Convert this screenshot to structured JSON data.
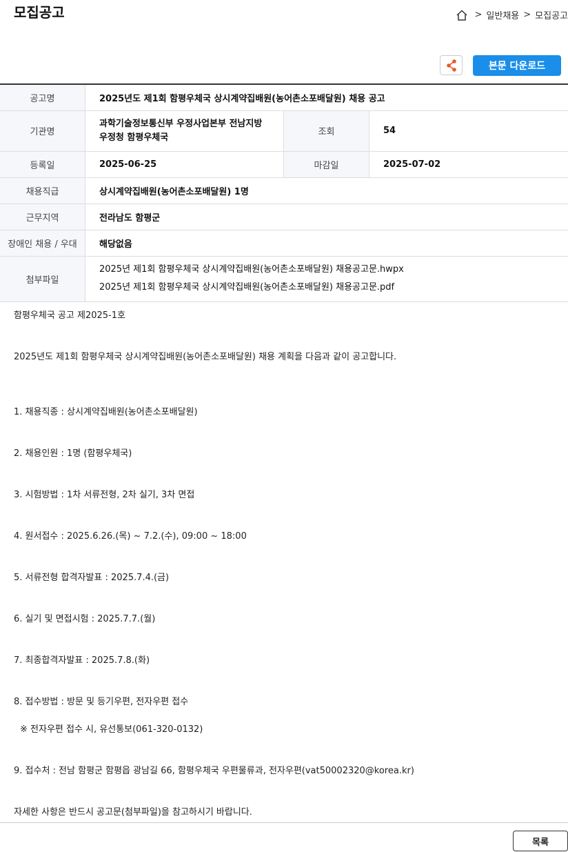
{
  "header": {
    "title": "모집공고",
    "breadcrumb": [
      "일반채용",
      "모집공고"
    ],
    "breadcrumb_sep": ">"
  },
  "actions": {
    "download_label": "본문 다운로드"
  },
  "info": {
    "title_label": "공고명",
    "title_value": "2025년도 제1회 함평우체국 상시계약집배원(농어촌소포배달원) 채용 공고",
    "agency_label": "기관명",
    "agency_line1": "과학기술정보통신부 우정사업본부 전남지방",
    "agency_line2": "우정청 함평우체국",
    "views_label": "조회",
    "views_value": "54",
    "reg_label": "등록일",
    "reg_value": "2025-06-25",
    "deadline_label": "마감일",
    "deadline_value": "2025-07-02",
    "position_label": "채용직급",
    "position_value": "상시계약집배원(농어촌소포배달원) 1명",
    "region_label": "근무지역",
    "region_value": "전라남도 함평군",
    "disabled_label": "장애인 채용 / 우대",
    "disabled_value": "해당없음",
    "files_label": "첨부파일",
    "files": [
      "2025년 제1회 함평우체국 상시계약집배원(농어촌소포배달원) 채용공고문.hwpx",
      "2025년 제1회 함평우체국 상시계약집배원(농어촌소포배달원) 채용공고문.pdf"
    ]
  },
  "body": {
    "lines": [
      "함평우체국 공고 제2025-1호",
      "2025년도 제1회 함평우체국 상시계약집배원(농어촌소포배달원) 채용 계획을 다음과 같이 공고합니다.",
      "1. 채용직종 : 상시계약집배원(농어촌소포배달원)",
      "2. 채용인원 : 1명 (함평우체국)",
      "3. 시험방법 : 1차 서류전형, 2차 실기, 3차 면접",
      "4. 원서접수 : 2025.6.26.(목) ~ 7.2.(수), 09:00 ~ 18:00",
      "5. 서류전형 합격자발표 : 2025.7.4.(금)",
      "6. 실기 및 면접시험 : 2025.7.7.(월)",
      "7. 최종합격자발표 : 2025.7.8.(화)",
      "8. 접수방법 : 방문 및 등기우편, 전자우편 접수",
      "※ 전자우편 접수 시,  유선통보(061-320-0132)",
      "9. 접수처 : 전남 함평군 함평읍 광남길 66, 함평우체국 우편물류과, 전자우편(vat50002320@korea.kr)",
      "자세한 사항은 반드시 공고문(첨부파일)을 참고하시기 바랍니다."
    ]
  },
  "footer": {
    "list_label": "목록"
  }
}
